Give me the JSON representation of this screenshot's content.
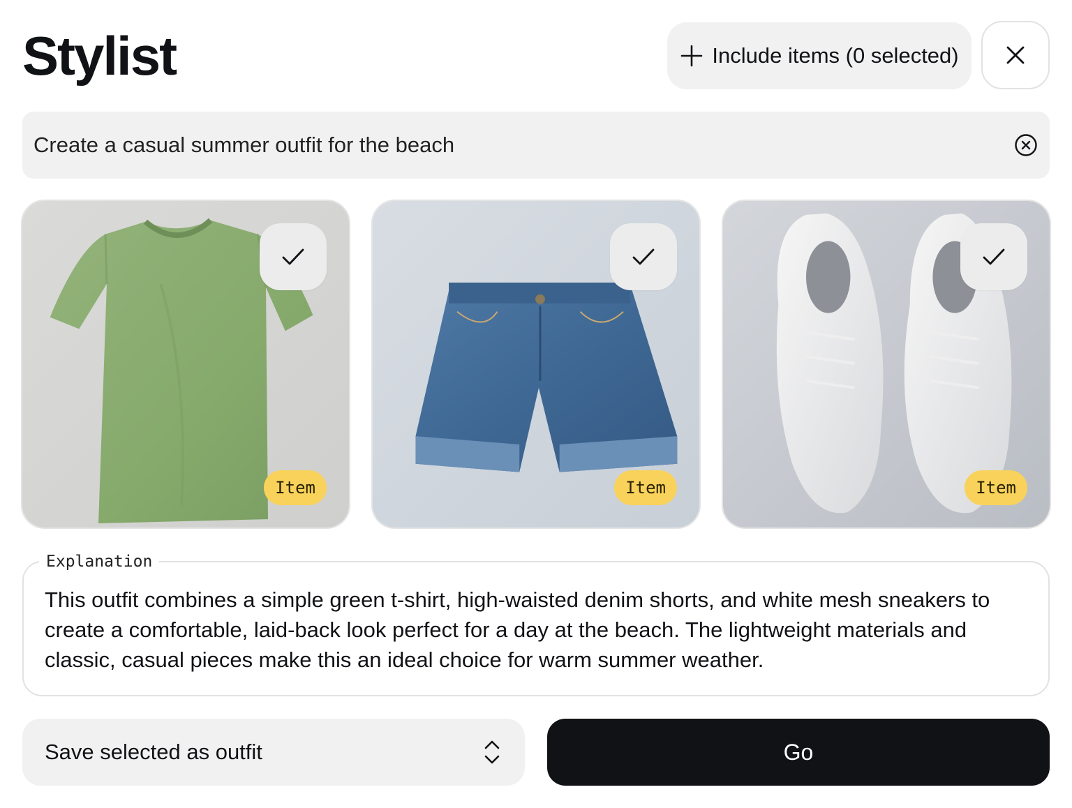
{
  "header": {
    "title": "Stylist",
    "include_button_label": "Include items (0 selected)",
    "icons": {
      "include": "plus-icon",
      "close": "close-icon"
    }
  },
  "prompt": {
    "value": "Create a casual summer outfit for the beach",
    "clear_icon": "circle-x-icon"
  },
  "items": [
    {
      "badge": "Item",
      "image": "green-tshirt",
      "selected": true,
      "check_icon": "check-icon"
    },
    {
      "badge": "Item",
      "image": "denim-shorts",
      "selected": true,
      "check_icon": "check-icon"
    },
    {
      "badge": "Item",
      "image": "white-sneakers",
      "selected": true,
      "check_icon": "check-icon"
    }
  ],
  "explanation": {
    "legend": "Explanation",
    "text": "This outfit combines a simple green t-shirt, high-waisted denim shorts, and white mesh sneakers to create a comfortable, laid-back look perfect for a day at the beach. The lightweight materials and classic, casual pieces make this an ideal choice for warm summer weather."
  },
  "footer": {
    "select_label": "Save selected as outfit",
    "select_icon": "chevron-up-down-icon",
    "go_label": "Go"
  },
  "colors": {
    "badge": "#f8d25a",
    "primary_button": "#111216",
    "surface": "#f1f1f1"
  }
}
